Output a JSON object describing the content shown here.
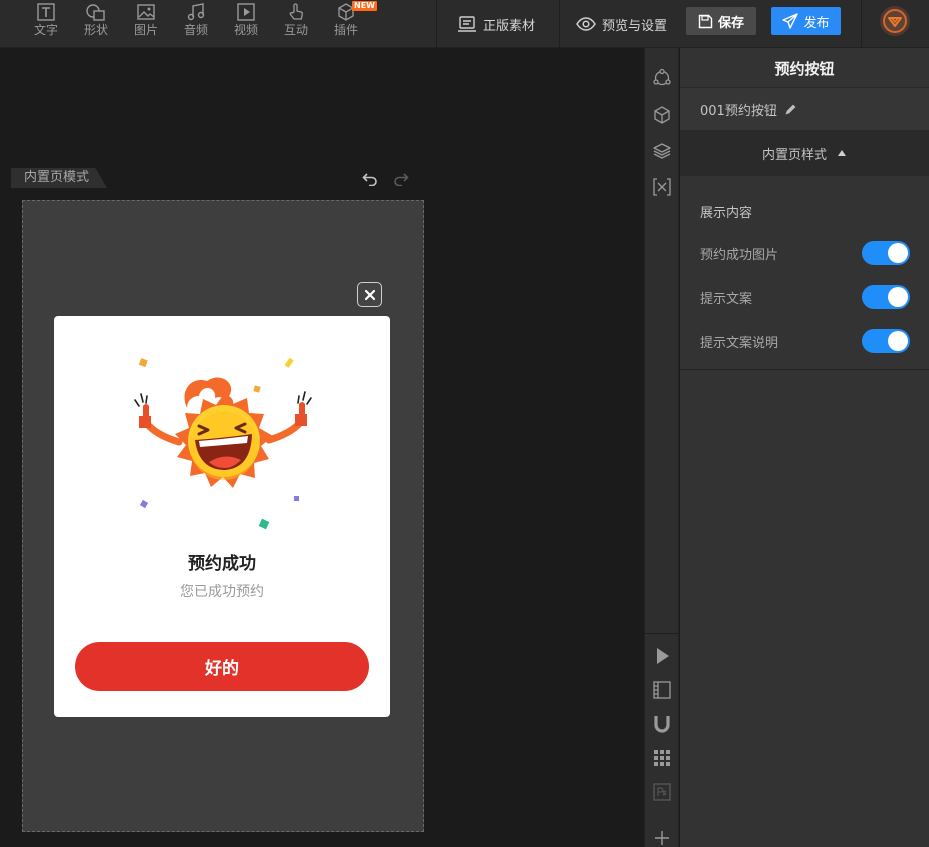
{
  "toolbar": {
    "tools": [
      {
        "label": "文字",
        "icon": "text-icon"
      },
      {
        "label": "形状",
        "icon": "shape-icon"
      },
      {
        "label": "图片",
        "icon": "image-icon"
      },
      {
        "label": "音频",
        "icon": "music-icon"
      },
      {
        "label": "视频",
        "icon": "video-icon"
      },
      {
        "label": "互动",
        "icon": "hand-pointer-icon"
      },
      {
        "label": "插件",
        "icon": "plugin-cube-icon",
        "badge": "NEW"
      }
    ],
    "assets_label": "正版素材",
    "preview_label": "预览与设置",
    "save_label": "保存",
    "publish_label": "发布"
  },
  "canvas": {
    "mode_tab": "内置页模式",
    "dialog": {
      "title": "预约成功",
      "description": "您已成功预约",
      "button_label": "好的"
    }
  },
  "panel": {
    "title": "预约按钮",
    "component_name": "001预约按钮",
    "section_label": "内置页样式",
    "sub_heading": "展示内容",
    "toggles": [
      {
        "label": "预约成功图片",
        "on": true
      },
      {
        "label": "提示文案",
        "on": true
      },
      {
        "label": "提示文案说明",
        "on": true
      }
    ]
  },
  "colors": {
    "accent_blue": "#1f8ef8",
    "publish_blue": "#2a8af6",
    "confirm_red": "#e3322a",
    "badge_orange": "#ff6a1a"
  }
}
